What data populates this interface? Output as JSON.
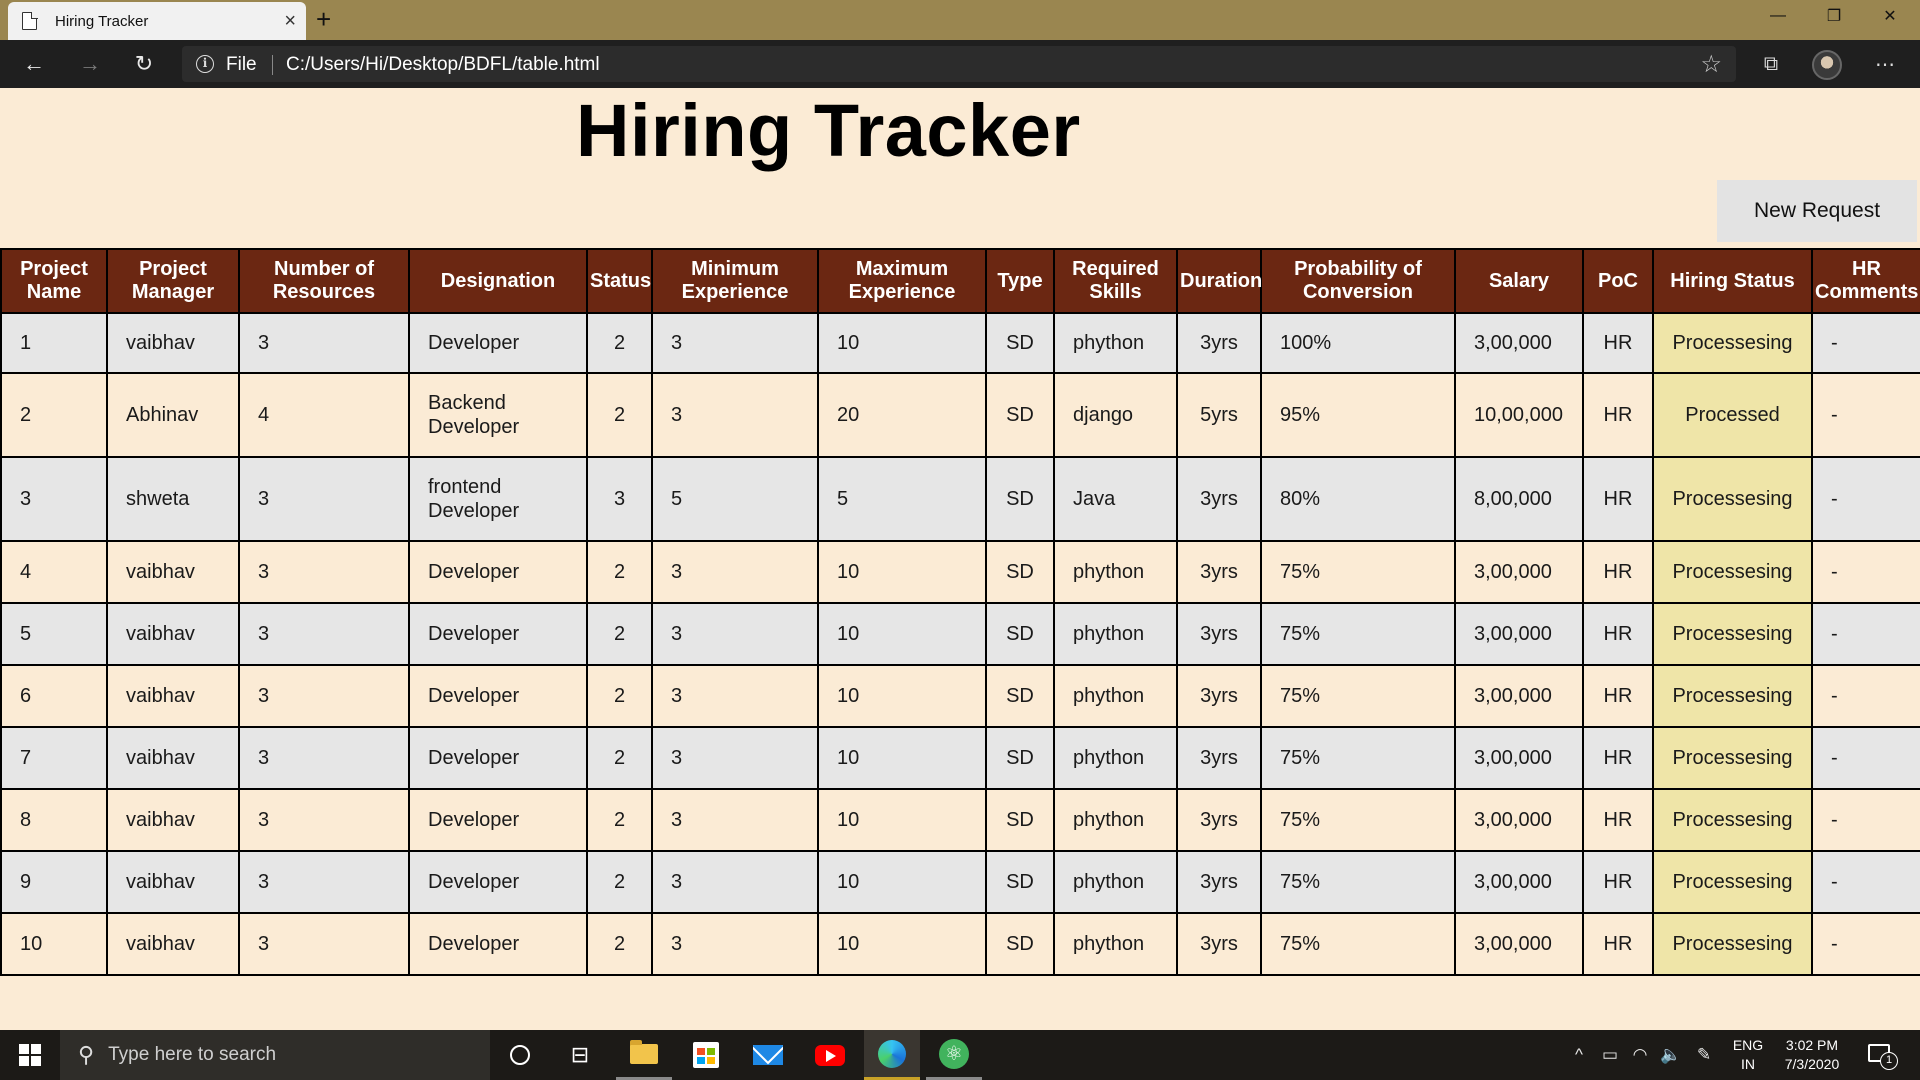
{
  "browser": {
    "tab_title": "Hiring Tracker",
    "tab_close": "×",
    "new_tab": "+",
    "file_label": "File",
    "url": "C:/Users/Hi/Desktop/BDFL/table.html",
    "controls": {
      "minimize": "—",
      "restore": "❐",
      "close": "✕"
    }
  },
  "page": {
    "title": "Hiring Tracker",
    "new_request_label": "New Request"
  },
  "table": {
    "headers": [
      "Project Name",
      "Project Manager",
      "Number of Resources",
      "Designation",
      "Status",
      "Minimum Experience",
      "Maximum Experience",
      "Type",
      "Required Skills",
      "Duration",
      "Probability of Conversion",
      "Salary",
      "PoC",
      "Hiring Status",
      "HR Comments"
    ],
    "rows": [
      [
        "1",
        "vaibhav",
        "3",
        "Developer",
        "2",
        "3",
        "10",
        "SD",
        "phython",
        "3yrs",
        "100%",
        "3,00,000",
        "HR",
        "Processesing",
        "-"
      ],
      [
        "2",
        "Abhinav",
        "4",
        "Backend Developer",
        "2",
        "3",
        "20",
        "SD",
        "django",
        "5yrs",
        "95%",
        "10,00,000",
        "HR",
        "Processed",
        "-"
      ],
      [
        "3",
        "shweta",
        "3",
        "frontend Developer",
        "3",
        "5",
        "5",
        "SD",
        "Java",
        "3yrs",
        "80%",
        "8,00,000",
        "HR",
        "Processesing",
        "-"
      ],
      [
        "4",
        "vaibhav",
        "3",
        "Developer",
        "2",
        "3",
        "10",
        "SD",
        "phython",
        "3yrs",
        "75%",
        "3,00,000",
        "HR",
        "Processesing",
        "-"
      ],
      [
        "5",
        "vaibhav",
        "3",
        "Developer",
        "2",
        "3",
        "10",
        "SD",
        "phython",
        "3yrs",
        "75%",
        "3,00,000",
        "HR",
        "Processesing",
        "-"
      ],
      [
        "6",
        "vaibhav",
        "3",
        "Developer",
        "2",
        "3",
        "10",
        "SD",
        "phython",
        "3yrs",
        "75%",
        "3,00,000",
        "HR",
        "Processesing",
        "-"
      ],
      [
        "7",
        "vaibhav",
        "3",
        "Developer",
        "2",
        "3",
        "10",
        "SD",
        "phython",
        "3yrs",
        "75%",
        "3,00,000",
        "HR",
        "Processesing",
        "-"
      ],
      [
        "8",
        "vaibhav",
        "3",
        "Developer",
        "2",
        "3",
        "10",
        "SD",
        "phython",
        "3yrs",
        "75%",
        "3,00,000",
        "HR",
        "Processesing",
        "-"
      ],
      [
        "9",
        "vaibhav",
        "3",
        "Developer",
        "2",
        "3",
        "10",
        "SD",
        "phython",
        "3yrs",
        "75%",
        "3,00,000",
        "HR",
        "Processesing",
        "-"
      ],
      [
        "10",
        "vaibhav",
        "3",
        "Developer",
        "2",
        "3",
        "10",
        "SD",
        "phython",
        "3yrs",
        "75%",
        "3,00,000",
        "HR",
        "Processesing",
        "-"
      ]
    ]
  },
  "taskbar": {
    "search_placeholder": "Type here to search",
    "language": "ENG",
    "region": "IN",
    "time": "3:02 PM",
    "date": "7/3/2020",
    "notification_count": "1"
  },
  "colors": {
    "page_background": "#fbebd5",
    "header_background": "#6b2712",
    "odd_row": "#e6e6e6",
    "hiring_status_cell": "#efe5a8",
    "titlebar": "#9a8650"
  }
}
